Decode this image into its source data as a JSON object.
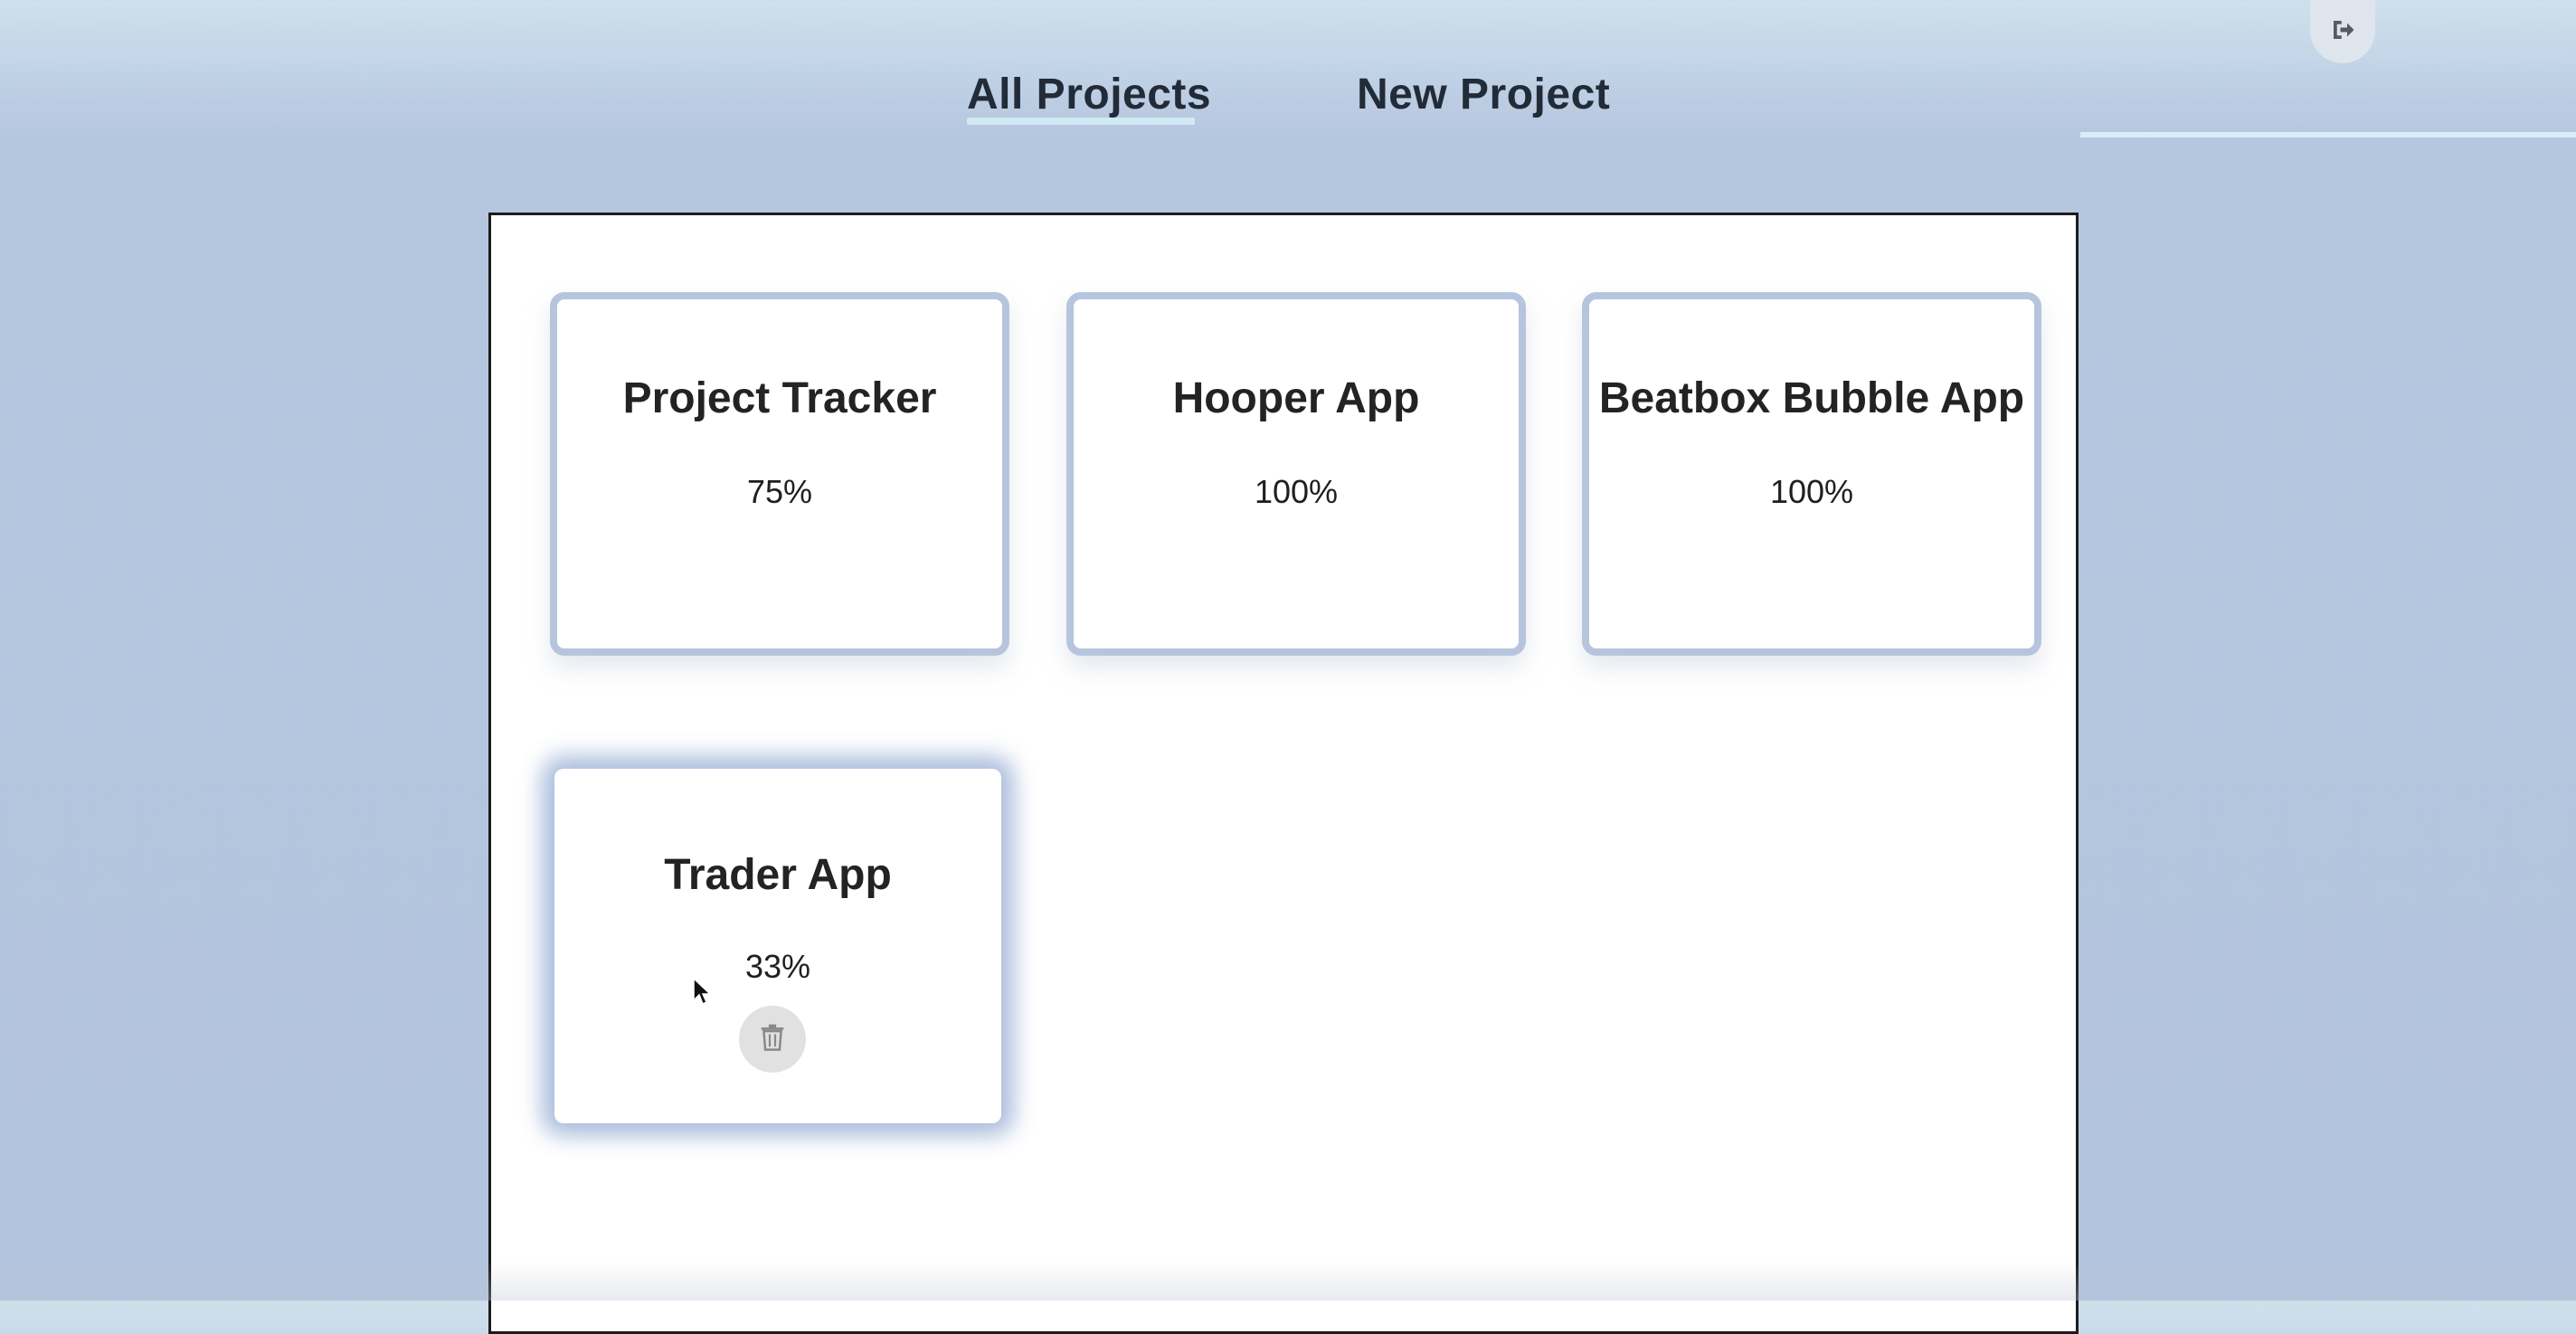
{
  "nav": {
    "tabs": [
      {
        "label": "All Projects",
        "active": true
      },
      {
        "label": "New Project",
        "active": false
      }
    ]
  },
  "header_icons": {
    "logout": "logout-icon"
  },
  "projects": [
    {
      "title": "Project Tracker",
      "progress": "75%"
    },
    {
      "title": "Hooper App",
      "progress": "100%"
    },
    {
      "title": "Beatbox Bubble App",
      "progress": "100%"
    },
    {
      "title": "Trader App",
      "progress": "33%",
      "hovered": true,
      "delete_icon": "trash-icon"
    }
  ],
  "colors": {
    "background": "#b3c4de",
    "card_border": "#b6c5dd",
    "active_underline": "#cfeaf3",
    "hover_glow": "#9cb2d6"
  }
}
